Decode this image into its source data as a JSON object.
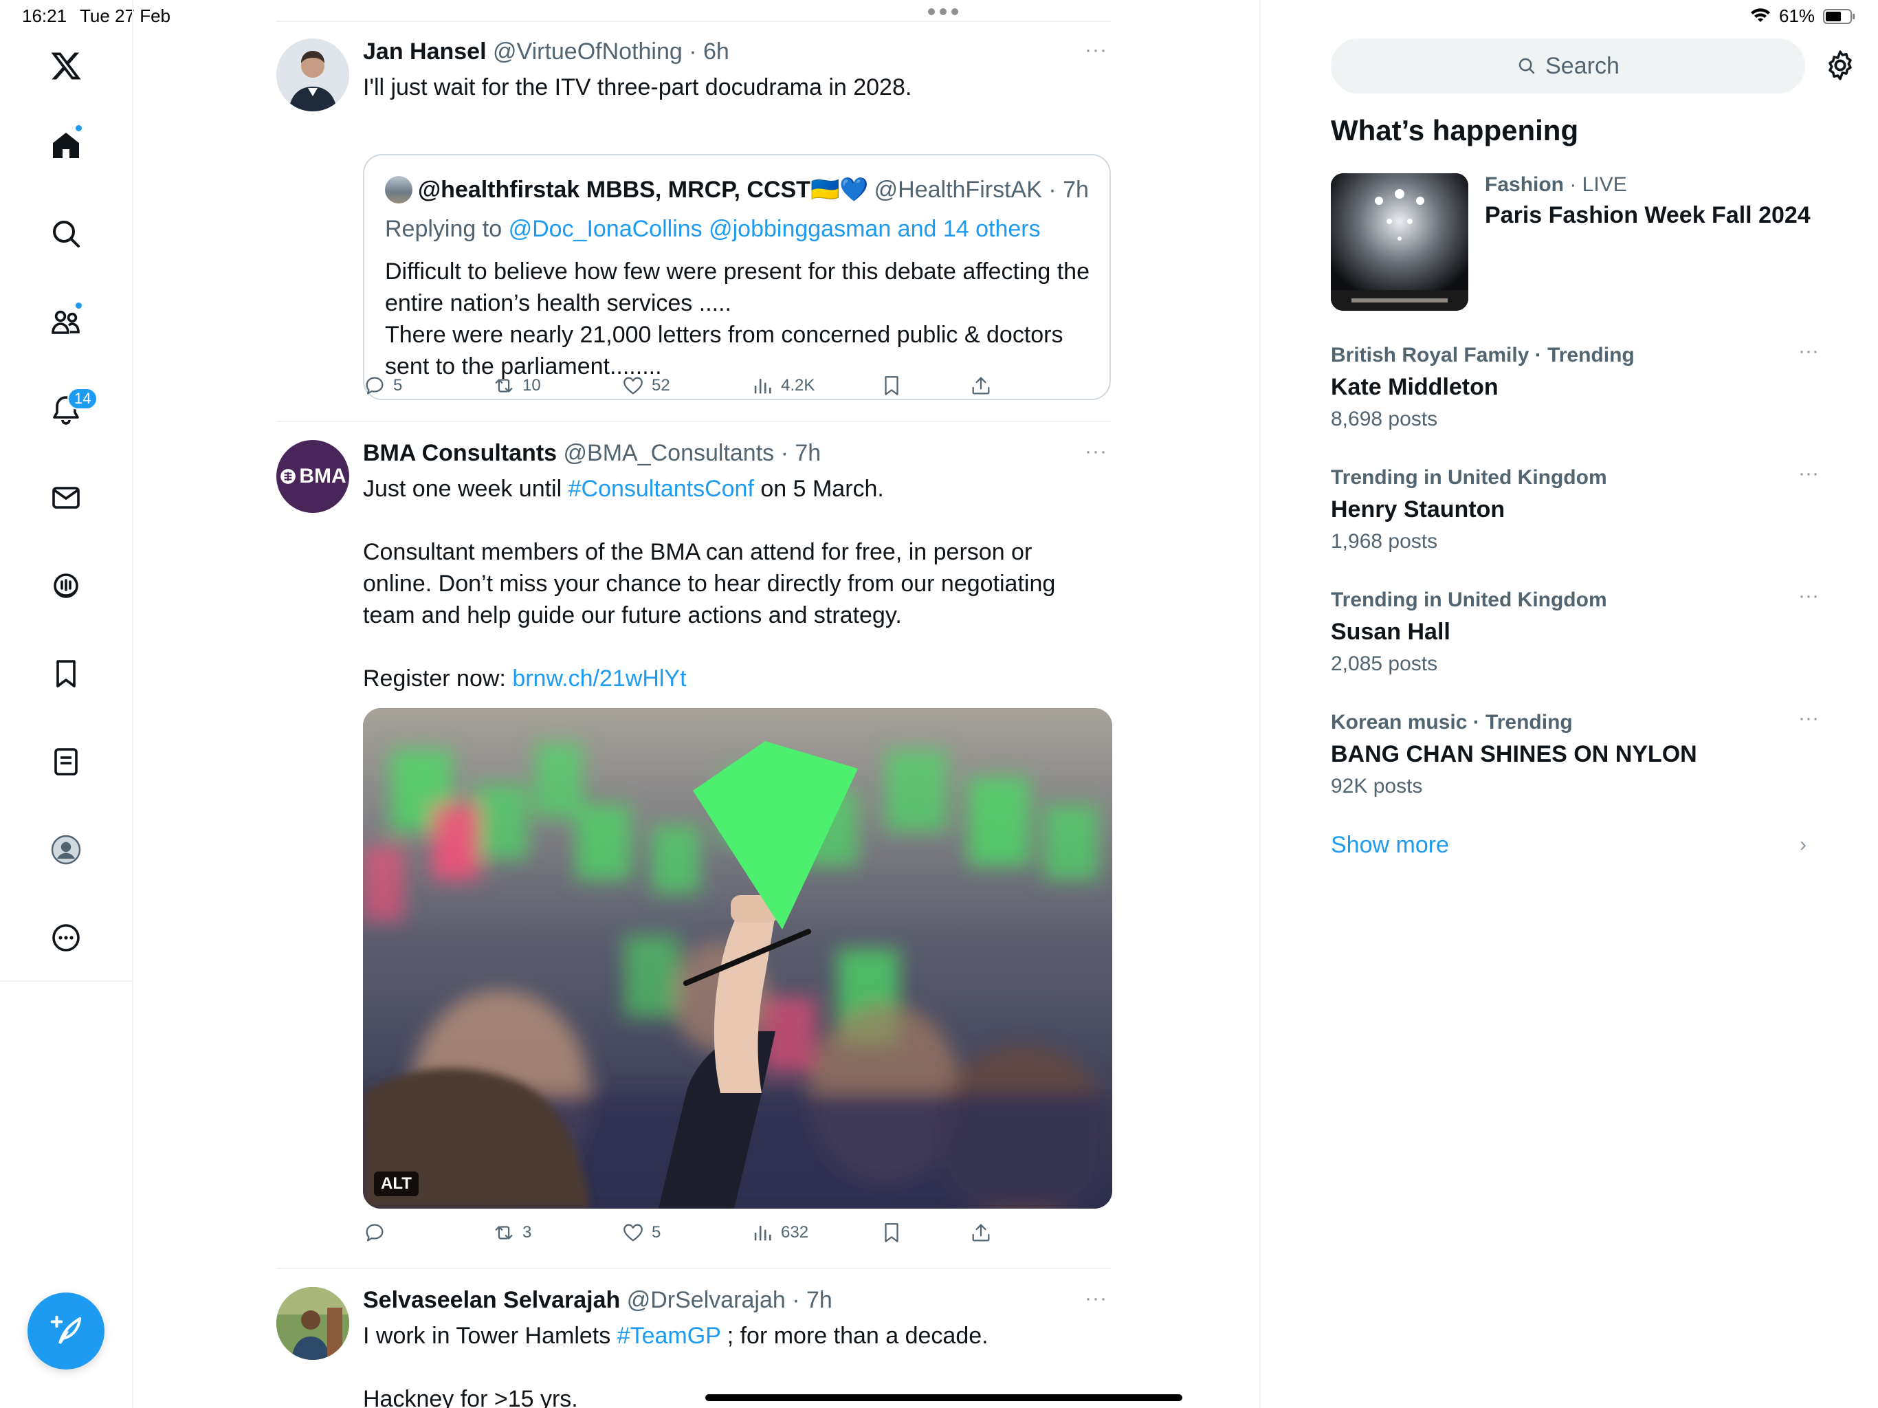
{
  "status_bar": {
    "time": "16:21",
    "date": "Tue 27 Feb",
    "battery": "61%"
  },
  "nav": {
    "notifications_badge": "14",
    "items": [
      "x-logo-icon",
      "home-icon",
      "search-icon",
      "communities-icon",
      "notifications-icon",
      "messages-icon",
      "spaces-icon",
      "bookmarks-icon",
      "lists-icon",
      "profile-icon",
      "more-icon"
    ]
  },
  "tweets": [
    {
      "name": "Jan Hansel",
      "meta": "@VirtueOfNothing · 6h",
      "more": "···",
      "text": "I'll just wait for the ITV three-part docudrama in 2028.",
      "quote": {
        "name": "@healthfirstak MBBS, MRCP, CCST🇺🇦💙",
        "meta": "@HealthFirstAK · 7h",
        "reply_prefix": "Replying to",
        "reply_to": "@Doc_IonaCollins @jobbinggasman and 14 others",
        "text_line1": "Difficult to believe how few were present for this debate affecting the entire nation’s health services .....",
        "text_line2": "There were nearly 21,000 letters from concerned public & doctors sent to the parliament........"
      },
      "actions": {
        "replies": "5",
        "reposts": "10",
        "likes": "52",
        "views": "4.2K"
      }
    },
    {
      "name": "BMA Consultants",
      "meta": "@BMA_Consultants · 7h",
      "more": "···",
      "avatar_text": "BMA",
      "text_a": "Just one week until ",
      "hashtag": "#ConsultantsConf",
      "text_b": " on 5 March.",
      "paragraph2": "Consultant members of the BMA can attend for free, in person or online. Don’t miss your chance to hear directly from our negotiating team and help guide our future actions and strategy.",
      "register_prefix": "Register now: ",
      "register_link": "brnw.ch/21wHlYt",
      "media_alt": "ALT",
      "actions": {
        "replies": "",
        "reposts": "3",
        "likes": "5",
        "views": "632"
      }
    },
    {
      "name": "Selvaseelan Selvarajah",
      "meta": "@DrSelvarajah · 7h",
      "more": "···",
      "text_a": "I work in Tower Hamlets ",
      "hashtag": "#TeamGP",
      "text_b": " ; for more than a decade.",
      "paragraph2": "Hackney for >15 yrs."
    }
  ],
  "sidebar": {
    "search_placeholder": "Search",
    "section_title": "What’s happening",
    "featured": {
      "category": "Fashion",
      "live": " · LIVE",
      "title": "Paris Fashion Week Fall 2024"
    },
    "trends": [
      {
        "context": "British Royal Family · Trending",
        "title": "Kate Middleton",
        "count": "8,698 posts"
      },
      {
        "context": "Trending in United Kingdom",
        "title": "Henry Staunton",
        "count": "1,968 posts"
      },
      {
        "context": "Trending in United Kingdom",
        "title": "Susan Hall",
        "count": "2,085 posts"
      },
      {
        "context": "Korean music · Trending",
        "title": "BANG CHAN SHINES ON NYLON",
        "count": "92K posts"
      }
    ],
    "show_more": "Show more",
    "trend_more": "···"
  },
  "colors": {
    "accent": "#1d9bf0",
    "text": "#0f1419",
    "muted": "#536471",
    "border": "#eff3f4"
  }
}
